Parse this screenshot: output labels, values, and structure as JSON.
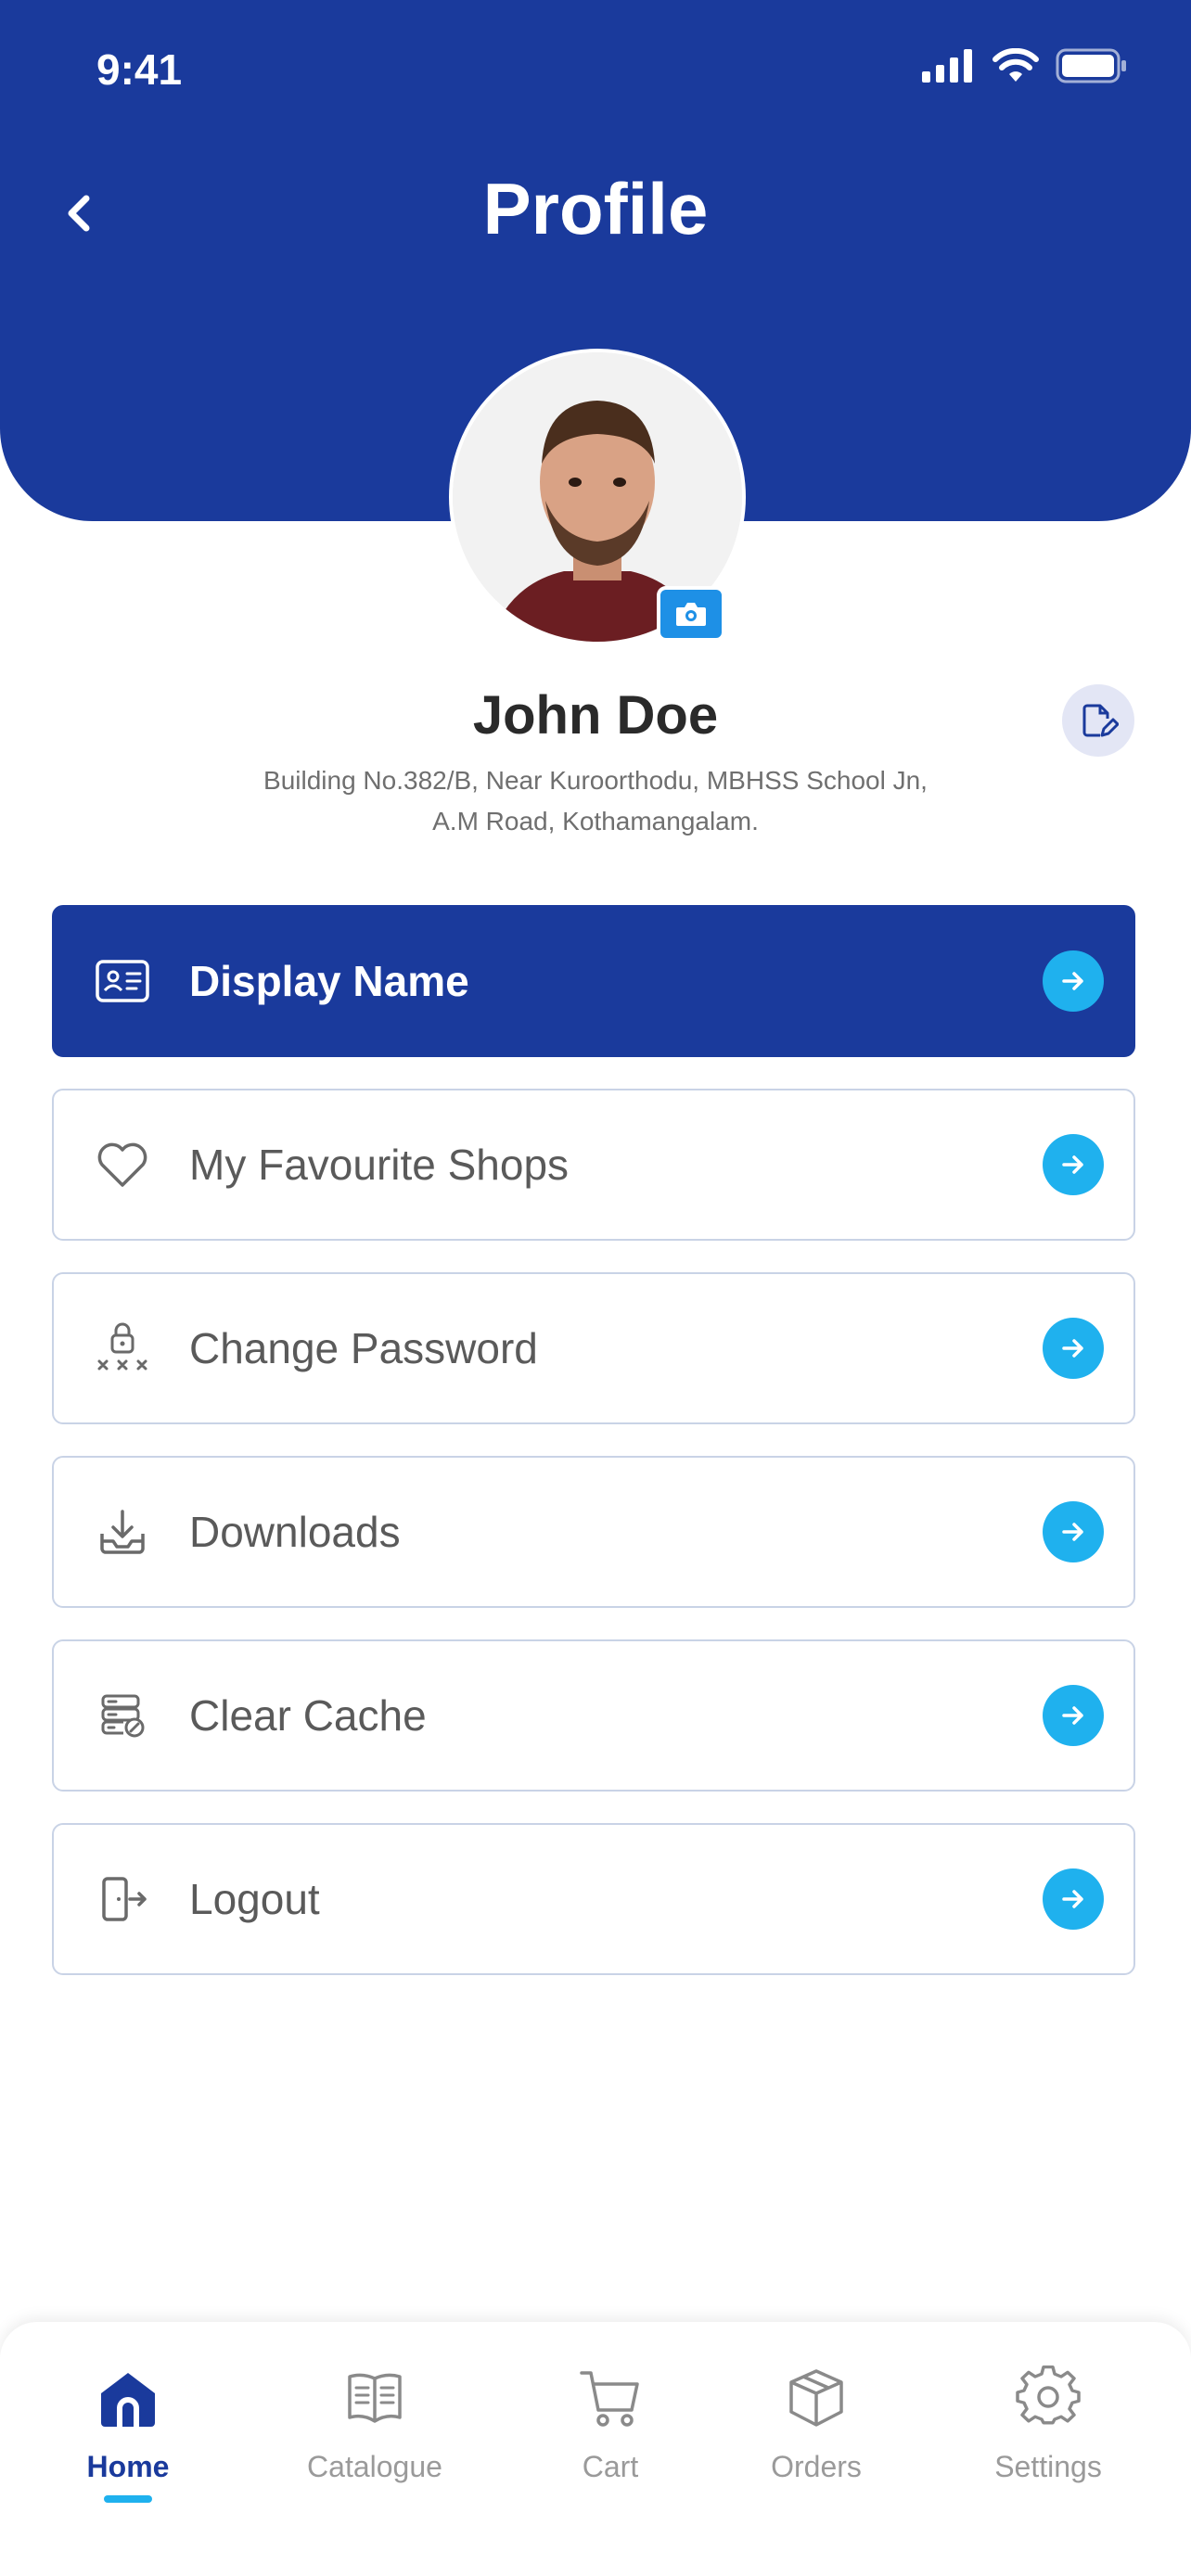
{
  "status_bar": {
    "time": "9:41"
  },
  "header": {
    "title": "Profile"
  },
  "profile": {
    "name": "John Doe",
    "address_line1": "Building No.382/B, Near Kuroorthodu, MBHSS School Jn,",
    "address_line2": "A.M Road, Kothamangalam."
  },
  "menu": [
    {
      "label": "Display Name",
      "icon": "id-card-icon",
      "active": true
    },
    {
      "label": "My Favourite Shops",
      "icon": "heart-icon",
      "active": false
    },
    {
      "label": "Change Password",
      "icon": "lock-icon",
      "active": false
    },
    {
      "label": "Downloads",
      "icon": "download-icon",
      "active": false
    },
    {
      "label": "Clear Cache",
      "icon": "cache-icon",
      "active": false
    },
    {
      "label": "Logout",
      "icon": "logout-icon",
      "active": false
    }
  ],
  "tabs": [
    {
      "label": "Home",
      "icon": "home-icon",
      "active": true
    },
    {
      "label": "Catalogue",
      "icon": "book-icon",
      "active": false
    },
    {
      "label": "Cart",
      "icon": "cart-icon",
      "active": false
    },
    {
      "label": "Orders",
      "icon": "box-icon",
      "active": false
    },
    {
      "label": "Settings",
      "icon": "gear-icon",
      "active": false
    }
  ],
  "colors": {
    "primary": "#1a3a9c",
    "accent": "#1fb1ee",
    "camera": "#1e90e6"
  }
}
